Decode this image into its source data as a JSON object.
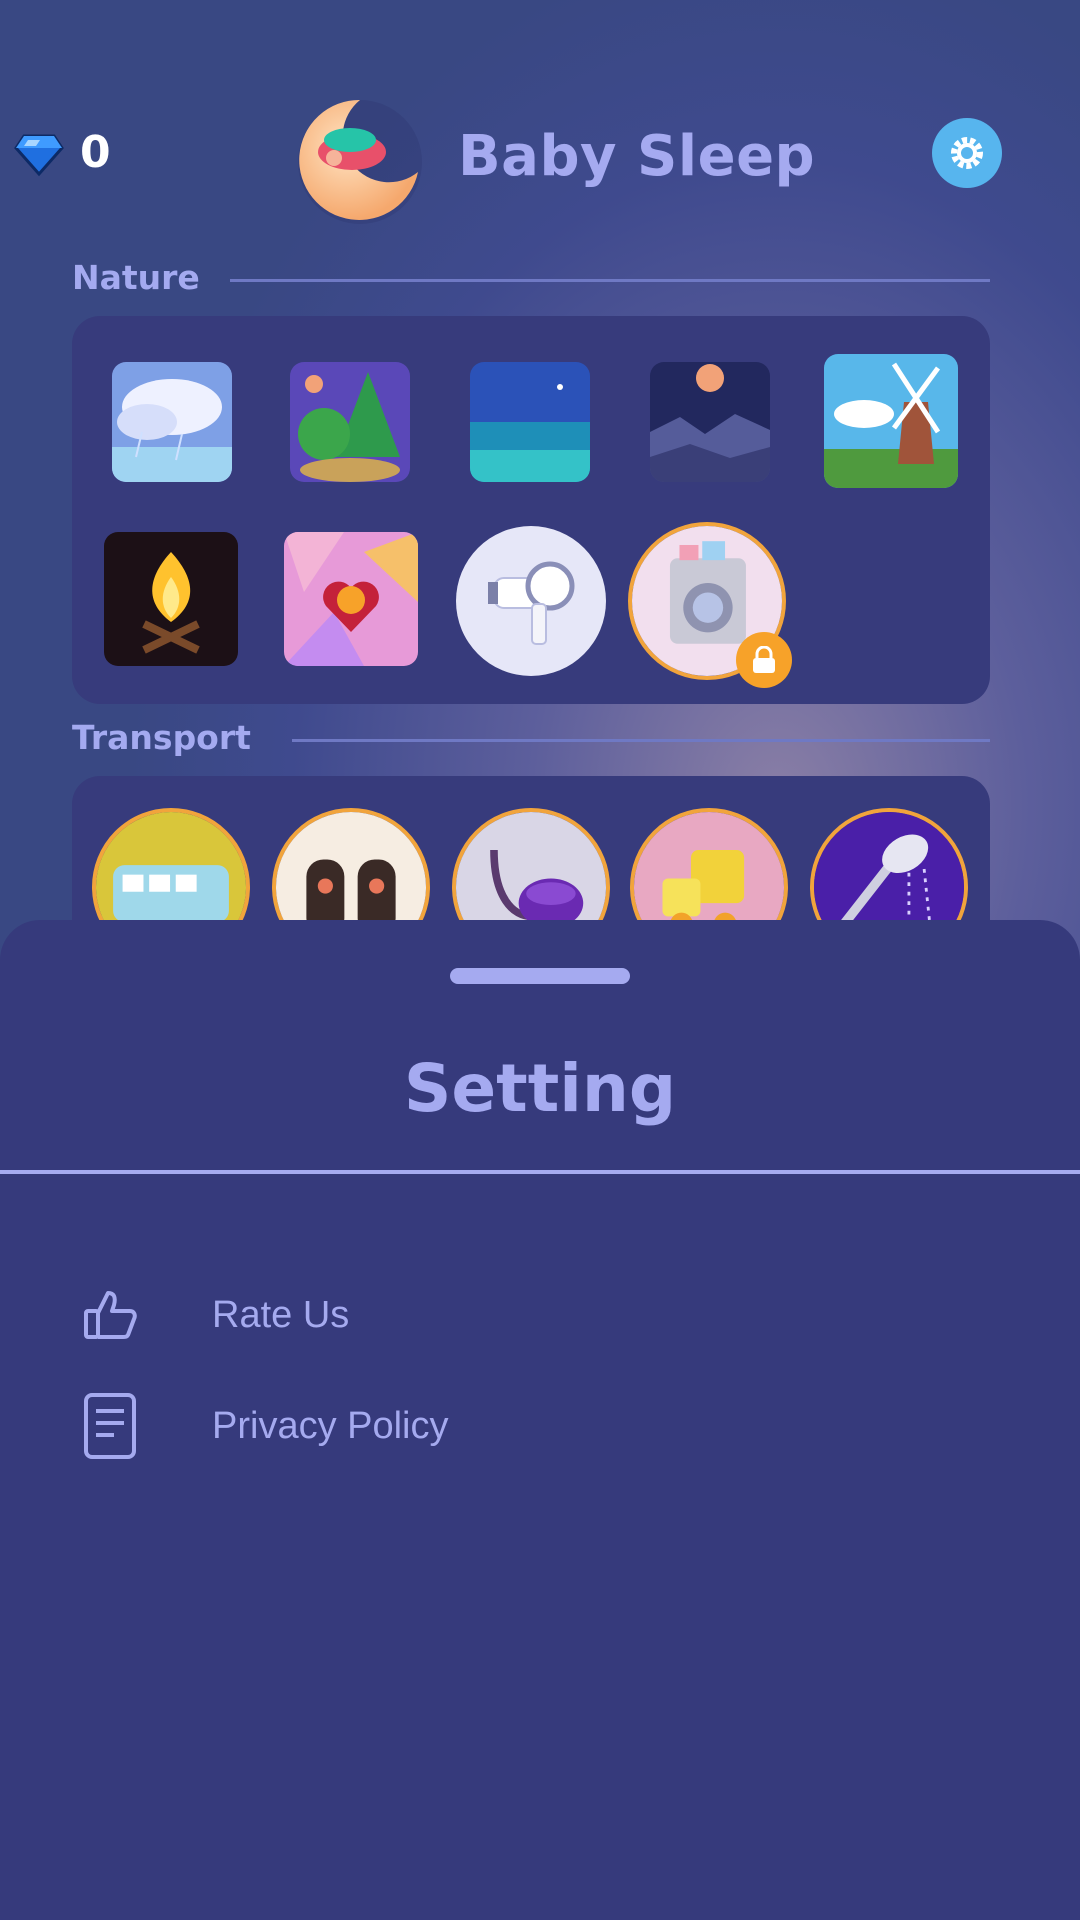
{
  "header": {
    "gem_count": "0",
    "app_title": "Baby Sleep"
  },
  "sections": {
    "nature": {
      "title": "Nature",
      "items": [
        "rain-cloud",
        "forest",
        "ocean",
        "moon-night",
        "windmill",
        "campfire",
        "heart-pattern",
        "hair-dryer",
        "washing-machine"
      ]
    },
    "transport": {
      "title": "Transport",
      "items": [
        "van",
        "car-seats",
        "vacuum",
        "toy-train",
        "shower"
      ]
    }
  },
  "settings_sheet": {
    "title": "Setting",
    "items": [
      {
        "label": "Rate Us",
        "icon": "thumbs-up-icon"
      },
      {
        "label": "Privacy Policy",
        "icon": "document-icon"
      }
    ]
  },
  "colors": {
    "accent": "#a5aaf0",
    "panel": "#373b7c",
    "lock_badge": "#f7a229",
    "settings_button": "#57b5ee"
  }
}
